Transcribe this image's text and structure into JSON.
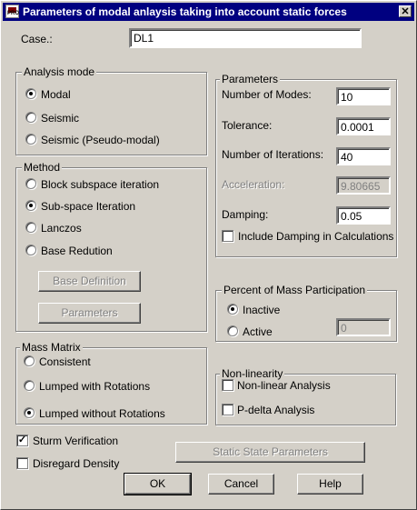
{
  "window": {
    "title": "Parameters of modal anlaysis taking into account static forces",
    "icon_text": "PRO"
  },
  "case": {
    "label": "Case.:",
    "value": "DL1"
  },
  "analysis_mode": {
    "legend": "Analysis mode",
    "options": [
      "Modal",
      "Seismic",
      "Seismic (Pseudo-modal)"
    ],
    "selected": "Modal"
  },
  "method": {
    "legend": "Method",
    "options": [
      "Block subspace iteration",
      "Sub-space Iteration",
      "Lanczos",
      "Base Redution"
    ],
    "selected": "Sub-space Iteration",
    "base_definition_label": "Base Definition",
    "parameters_label": "Parameters"
  },
  "parameters": {
    "legend": "Parameters",
    "modes_label": "Number of Modes:",
    "modes_value": "10",
    "tolerance_label": "Tolerance:",
    "tolerance_value": "0.0001",
    "iterations_label": "Number of Iterations:",
    "iterations_value": "40",
    "acceleration_label": "Acceleration:",
    "acceleration_value": "9.80665",
    "damping_label": "Damping:",
    "damping_value": "0.05",
    "include_damping_label": "Include Damping in Calculations",
    "include_damping_checked": false
  },
  "mass_participation": {
    "legend": "Percent of Mass Participation",
    "inactive_label": "Inactive",
    "active_label": "Active",
    "selected": "Inactive",
    "value": "0"
  },
  "mass_matrix": {
    "legend": "Mass Matrix",
    "options": [
      "Consistent",
      "Lumped with Rotations",
      "Lumped without Rotations"
    ],
    "selected": "Lumped without Rotations"
  },
  "nonlinearity": {
    "legend": "Non-linearity",
    "nonlinear_label": "Non-linear Analysis",
    "pdelta_label": "P-delta Analysis",
    "nonlinear_checked": false,
    "pdelta_checked": false
  },
  "sturm": {
    "label": "Sturm Verification",
    "checked": true
  },
  "disregard_density": {
    "label": "Disregard Density",
    "checked": false
  },
  "buttons": {
    "static_state": "Static State Parameters",
    "ok": "OK",
    "cancel": "Cancel",
    "help": "Help"
  }
}
